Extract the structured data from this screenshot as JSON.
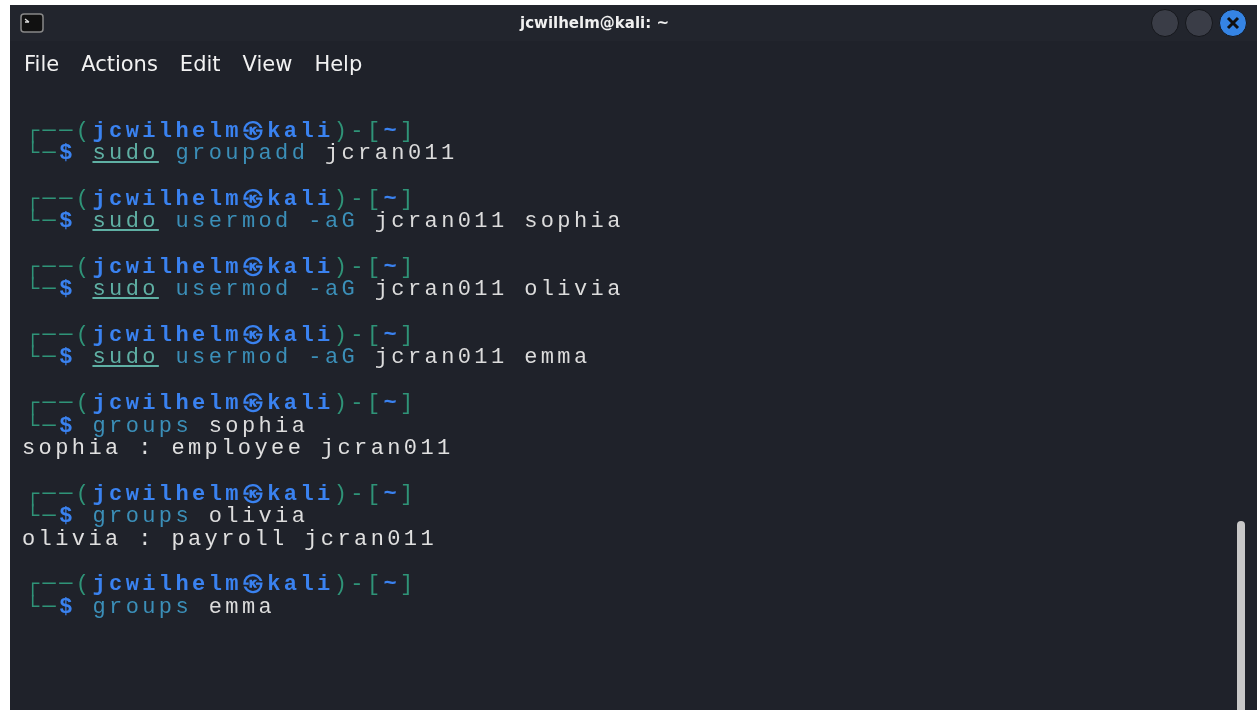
{
  "window": {
    "title": "jcwilhelm@kali: ~"
  },
  "menu": [
    "File",
    "Actions",
    "Edit",
    "View",
    "Help"
  ],
  "blocks": [
    {
      "prompt": {
        "open": "┌──(",
        "user": "jcwilhelm",
        "at": "㉿",
        "host": "kali",
        "mid": ")-[",
        "dir": "~",
        "close": "]",
        "mark": "└─$"
      },
      "command": [
        {
          "kind": "sudo",
          "text": "sudo"
        },
        {
          "kind": "program",
          "text": "groupadd"
        },
        {
          "kind": "arg",
          "text": "jcran011"
        }
      ]
    },
    {
      "prompt": {
        "open": "┌──(",
        "user": "jcwilhelm",
        "at": "㉿",
        "host": "kali",
        "mid": ")-[",
        "dir": "~",
        "close": "]",
        "mark": "└─$"
      },
      "command": [
        {
          "kind": "sudo",
          "text": "sudo"
        },
        {
          "kind": "program",
          "text": "usermod"
        },
        {
          "kind": "option",
          "text": "-aG"
        },
        {
          "kind": "arg",
          "text": "jcran011"
        },
        {
          "kind": "arg",
          "text": "sophia"
        }
      ]
    },
    {
      "prompt": {
        "open": "┌──(",
        "user": "jcwilhelm",
        "at": "㉿",
        "host": "kali",
        "mid": ")-[",
        "dir": "~",
        "close": "]",
        "mark": "└─$"
      },
      "command": [
        {
          "kind": "sudo",
          "text": "sudo"
        },
        {
          "kind": "program",
          "text": "usermod"
        },
        {
          "kind": "option",
          "text": "-aG"
        },
        {
          "kind": "arg",
          "text": "jcran011"
        },
        {
          "kind": "arg",
          "text": "olivia"
        }
      ]
    },
    {
      "prompt": {
        "open": "┌──(",
        "user": "jcwilhelm",
        "at": "㉿",
        "host": "kali",
        "mid": ")-[",
        "dir": "~",
        "close": "]",
        "mark": "└─$"
      },
      "command": [
        {
          "kind": "sudo",
          "text": "sudo"
        },
        {
          "kind": "program",
          "text": "usermod"
        },
        {
          "kind": "option",
          "text": "-aG"
        },
        {
          "kind": "arg",
          "text": "jcran011"
        },
        {
          "kind": "arg",
          "text": "emma"
        }
      ]
    },
    {
      "prompt": {
        "open": "┌──(",
        "user": "jcwilhelm",
        "at": "㉿",
        "host": "kali",
        "mid": ")-[",
        "dir": "~",
        "close": "]",
        "mark": "└─$"
      },
      "command": [
        {
          "kind": "program",
          "text": "groups"
        },
        {
          "kind": "arg",
          "text": "sophia"
        }
      ],
      "output": [
        "sophia : employee jcran011"
      ]
    },
    {
      "prompt": {
        "open": "┌──(",
        "user": "jcwilhelm",
        "at": "㉿",
        "host": "kali",
        "mid": ")-[",
        "dir": "~",
        "close": "]",
        "mark": "└─$"
      },
      "command": [
        {
          "kind": "program",
          "text": "groups"
        },
        {
          "kind": "arg",
          "text": "olivia"
        }
      ],
      "output": [
        "olivia : payroll jcran011"
      ]
    },
    {
      "prompt": {
        "open": "┌──(",
        "user": "jcwilhelm",
        "at": "㉿",
        "host": "kali",
        "mid": ")-[",
        "dir": "~",
        "close": "]",
        "mark": "└─$"
      },
      "command": [
        {
          "kind": "program",
          "text": "groups"
        },
        {
          "kind": "arg",
          "text": "emma"
        }
      ]
    }
  ]
}
